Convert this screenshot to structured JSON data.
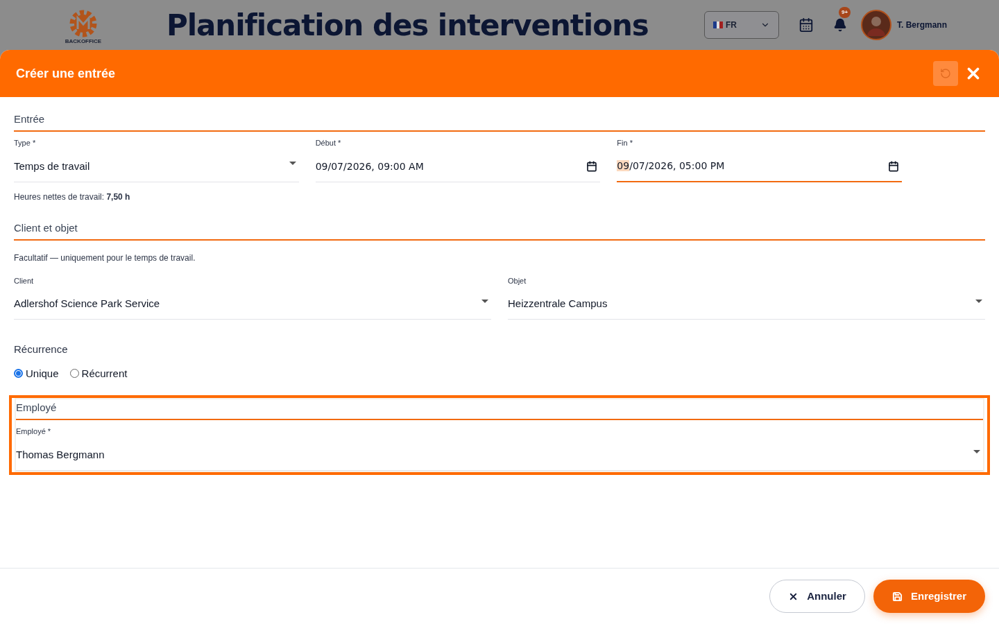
{
  "app_header": {
    "logo_text": "BACKOFFICE",
    "title": "Planification des interventions",
    "language": "FR",
    "notification_badge": "9+",
    "user_name": "T. Bergmann"
  },
  "dialog": {
    "title": "Créer une entrée",
    "entry_section": {
      "title": "Entrée",
      "fields": [
        {
          "kind": "select",
          "label": "Type *",
          "value": "Temps de travail",
          "focused": false
        },
        {
          "kind": "date",
          "label": "Début *",
          "value": "09/07/2026, 09:00 AM",
          "focused": false
        },
        {
          "kind": "date",
          "label": "Fin *",
          "value": "09/07/2026, 05:00 PM",
          "focused": true
        }
      ],
      "hint": "Heures nettes de travail: **7,50 h**"
    },
    "client_section": {
      "title": "Client et objet",
      "hint": "Facultatif — uniquement pour le temps de travail.",
      "fields": [
        {
          "kind": "select",
          "label": "Client",
          "value": "Adlershof Science Park Service",
          "focused": false
        },
        {
          "kind": "select",
          "label": "Objet",
          "value": "Heizzentrale Campus",
          "focused": false
        }
      ]
    },
    "recurrence": {
      "title": "Récurrence",
      "options": [
        {
          "label": "Unique",
          "selected": true
        },
        {
          "label": "Récurrent",
          "selected": false
        }
      ]
    },
    "employee_section": {
      "title": "Employé",
      "highlighted": true,
      "fields": [
        {
          "kind": "select",
          "label": "Employé *",
          "value": "Thomas Bergmann",
          "focused": false
        }
      ]
    },
    "buttons": [
      {
        "kind": "cancel",
        "label": "Annuler"
      },
      {
        "kind": "save",
        "label": "Enregistrer"
      }
    ]
  }
}
